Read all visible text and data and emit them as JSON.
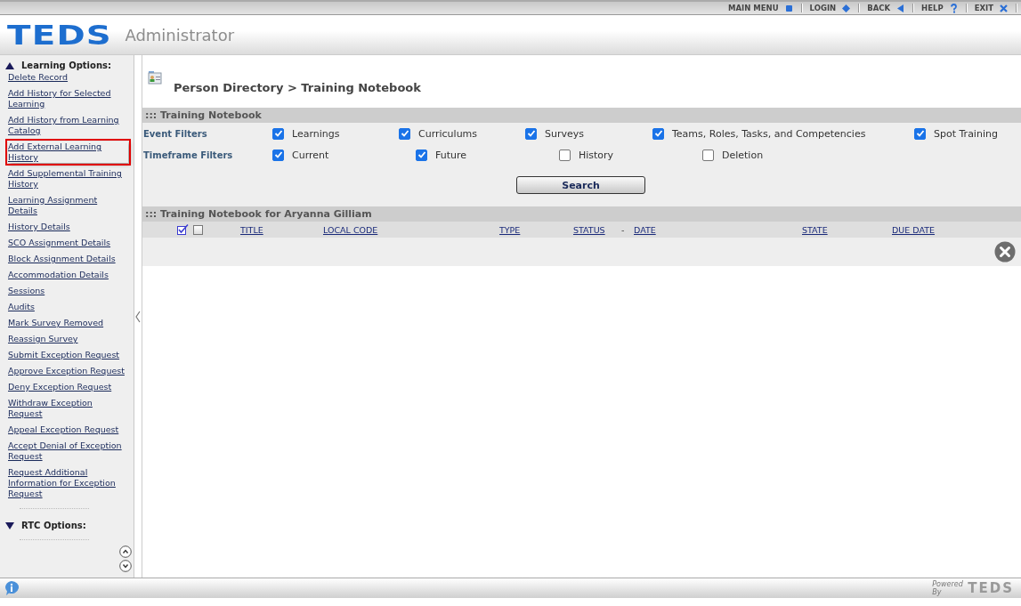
{
  "top_nav": [
    {
      "label": "MAIN MENU"
    },
    {
      "label": "LOGIN"
    },
    {
      "label": "BACK"
    },
    {
      "label": "HELP"
    },
    {
      "label": "EXIT"
    }
  ],
  "header": {
    "logo": "TEDS",
    "title": "Administrator"
  },
  "sidebar": {
    "sections": [
      {
        "title": "Learning Options:",
        "expanded": true,
        "items": [
          {
            "label": "Delete Record",
            "highlighted": false
          },
          {
            "label": "Add History for Selected Learning",
            "highlighted": false
          },
          {
            "label": "Add History from Learning Catalog",
            "highlighted": false
          },
          {
            "label": "Add External Learning History",
            "highlighted": true
          },
          {
            "label": "Add Supplemental Training History",
            "highlighted": false
          },
          {
            "label": "Learning Assignment Details",
            "highlighted": false
          },
          {
            "label": "History Details",
            "highlighted": false
          },
          {
            "label": "SCO Assignment Details",
            "highlighted": false
          },
          {
            "label": "Block Assignment Details",
            "highlighted": false
          },
          {
            "label": "Accommodation Details",
            "highlighted": false
          },
          {
            "label": "Sessions",
            "highlighted": false
          },
          {
            "label": "Audits",
            "highlighted": false
          },
          {
            "label": "Mark Survey Removed",
            "highlighted": false
          },
          {
            "label": "Reassign Survey",
            "highlighted": false
          },
          {
            "label": "Submit Exception Request",
            "highlighted": false
          },
          {
            "label": "Approve Exception Request",
            "highlighted": false
          },
          {
            "label": "Deny Exception Request",
            "highlighted": false
          },
          {
            "label": "Withdraw Exception Request",
            "highlighted": false
          },
          {
            "label": "Appeal Exception Request",
            "highlighted": false
          },
          {
            "label": "Accept Denial of Exception Request",
            "highlighted": false
          },
          {
            "label": "Request Additional Information for Exception Request",
            "highlighted": false
          }
        ]
      },
      {
        "title": "RTC Options:",
        "expanded": false
      }
    ]
  },
  "breadcrumb": "Person Directory > Training Notebook",
  "filters_panel": {
    "title": "::: Training Notebook",
    "rows": [
      {
        "label": "Event Filters",
        "options": [
          {
            "label": "Learnings",
            "checked": true
          },
          {
            "label": "Curriculums",
            "checked": true
          },
          {
            "label": "Surveys",
            "checked": true
          },
          {
            "label": "Teams, Roles, Tasks, and Competencies",
            "checked": true
          },
          {
            "label": "Spot Training",
            "checked": true
          }
        ]
      },
      {
        "label": "Timeframe Filters",
        "options": [
          {
            "label": "Current",
            "checked": true
          },
          {
            "label": "Future",
            "checked": true
          },
          {
            "label": "History",
            "checked": false
          },
          {
            "label": "Deletion",
            "checked": false
          }
        ]
      }
    ],
    "button": "Search"
  },
  "results": {
    "title": "::: Training Notebook for Aryanna Gilliam",
    "header_checkbox": {
      "checked": false
    },
    "columns": [
      "TITLE",
      "LOCAL CODE",
      "TYPE",
      "STATUS",
      "-",
      "DATE",
      "STATE",
      "DUE DATE"
    ]
  },
  "footer": {
    "powered_by": "Powered By",
    "logo": "TEDS"
  }
}
